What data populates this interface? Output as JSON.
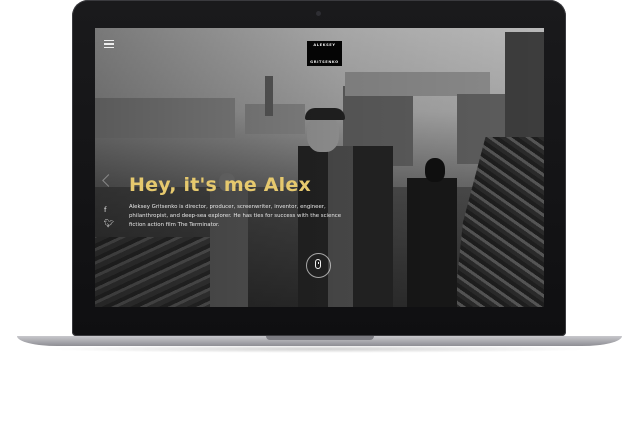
{
  "site": {
    "logo_line1": "ALEKSEY",
    "logo_line2": "GRITSENKO",
    "headline": "Hey, it's me Alex",
    "bio": "Aleksey Gritsenko is director, producer, screenwriter, inventor, engineer, philanthropist, and deep-sea explorer. He has ties for success with the science fiction action film The Terminator."
  },
  "icons": {
    "menu": "hamburger-menu-icon",
    "prev": "chevron-left-icon",
    "facebook": "facebook-icon",
    "twitter": "twitter-icon",
    "scroll": "mouse-scroll-icon"
  },
  "colors": {
    "headline": "#e6c96e",
    "logo_bg": "#050505",
    "laptop_frame": "#151517"
  }
}
